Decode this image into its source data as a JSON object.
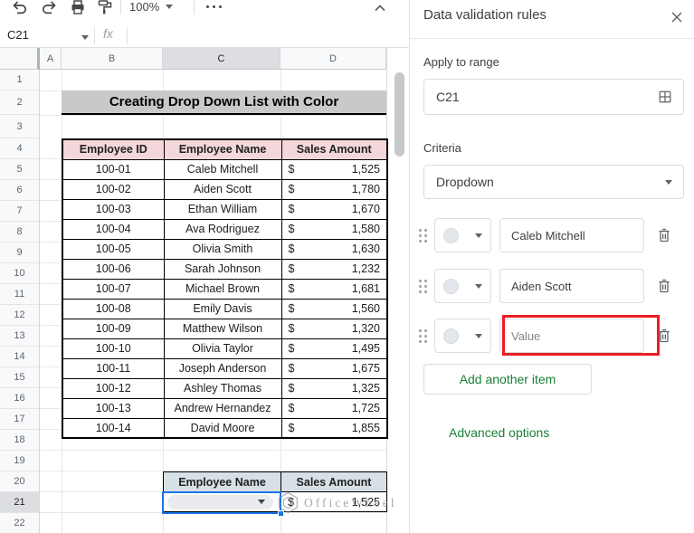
{
  "toolbar": {
    "zoom_value": "100%",
    "icons": [
      "undo-icon",
      "redo-icon",
      "print-icon",
      "paint-format-icon",
      "more-icon",
      "collapse-toolbar-icon"
    ]
  },
  "formula_bar": {
    "cell_ref": "C21",
    "fx": "fx"
  },
  "grid": {
    "columns": [
      "A",
      "B",
      "C",
      "D"
    ],
    "rows": [
      "1",
      "2",
      "3",
      "4",
      "5",
      "6",
      "7",
      "8",
      "9",
      "10",
      "11",
      "12",
      "13",
      "14",
      "15",
      "16",
      "17",
      "18",
      "19",
      "20",
      "21",
      "22"
    ],
    "selected_cell": "C21"
  },
  "content": {
    "title": "Creating Drop Down List with Color",
    "main_table": {
      "headers": [
        "Employee ID",
        "Employee Name",
        "Sales Amount"
      ],
      "currency": "$",
      "rows": [
        {
          "id": "100-01",
          "name": "Caleb Mitchell",
          "amount": "1,525"
        },
        {
          "id": "100-02",
          "name": "Aiden Scott",
          "amount": "1,780"
        },
        {
          "id": "100-03",
          "name": "Ethan William",
          "amount": "1,670"
        },
        {
          "id": "100-04",
          "name": "Ava Rodriguez",
          "amount": "1,580"
        },
        {
          "id": "100-05",
          "name": "Olivia Smith",
          "amount": "1,630"
        },
        {
          "id": "100-06",
          "name": "Sarah Johnson",
          "amount": "1,232"
        },
        {
          "id": "100-07",
          "name": "Michael Brown",
          "amount": "1,681"
        },
        {
          "id": "100-08",
          "name": "Emily Davis",
          "amount": "1,560"
        },
        {
          "id": "100-09",
          "name": "Matthew Wilson",
          "amount": "1,320"
        },
        {
          "id": "100-10",
          "name": "Olivia Taylor",
          "amount": "1,495"
        },
        {
          "id": "100-11",
          "name": "Joseph Anderson",
          "amount": "1,675"
        },
        {
          "id": "100-12",
          "name": "Ashley Thomas",
          "amount": "1,325"
        },
        {
          "id": "100-13",
          "name": "Andrew Hernandez",
          "amount": "1,725"
        },
        {
          "id": "100-14",
          "name": "David Moore",
          "amount": "1,855"
        }
      ]
    },
    "summary_table": {
      "name_header": "Employee Name",
      "sales_header": "Sales Amount",
      "currency": "$",
      "amount": "1,525"
    },
    "watermark_text": "OfficeWheel"
  },
  "panel": {
    "title": "Data validation rules",
    "apply_to_range_label": "Apply to range",
    "range_value": "C21",
    "criteria_label": "Criteria",
    "criteria_value": "Dropdown",
    "items": [
      {
        "value": "Caleb Mitchell"
      },
      {
        "value": "Aiden Scott"
      },
      {
        "value": "Value"
      }
    ],
    "add_item_label": "Add another item",
    "advanced_label": "Advanced options",
    "colors": {
      "green": "#188038",
      "red_highlight": "#eb1d24",
      "selection_blue": "#1a73e8",
      "header_pink": "#f3d7da",
      "header_blue_gray": "#d7e0e4",
      "title_gray": "#c9c9c9"
    }
  }
}
